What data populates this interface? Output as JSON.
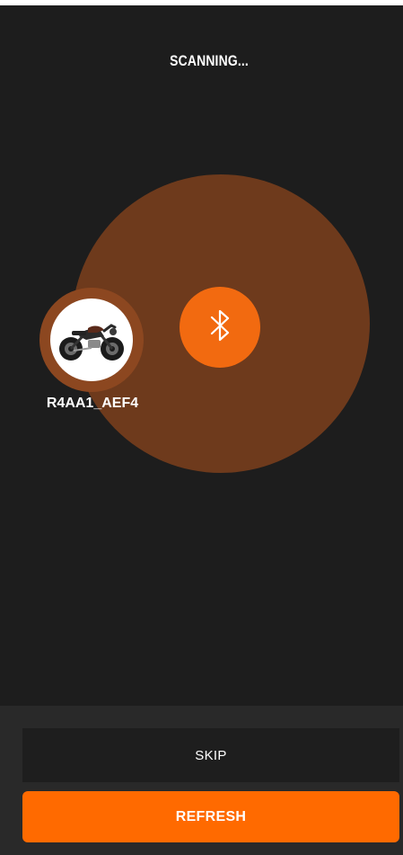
{
  "header": {
    "title": "SCANNING..."
  },
  "scanner": {
    "center_icon": "bluetooth-icon",
    "accent_color": "#f26a10",
    "pulse_color": "#6e3a1c"
  },
  "devices": [
    {
      "name": "R4AA1_AEF4",
      "icon": "motorcycle-image"
    }
  ],
  "actions": {
    "skip_label": "SKIP",
    "refresh_label": "REFRESH",
    "refresh_color": "#ff6a00"
  }
}
